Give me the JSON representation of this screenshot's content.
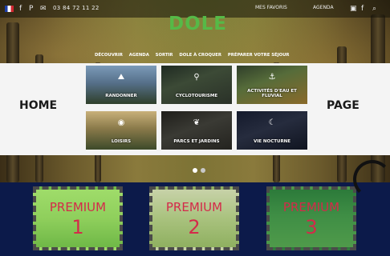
{
  "topbar": {
    "phone": "03 84 72 11 22",
    "left_icons": [
      "flag-icon",
      "facebook-icon",
      "pinterest-icon",
      "mail-icon"
    ],
    "right_link_a": "MES FAVORIS",
    "right_link_b": "AGENDA",
    "right_icons": [
      "bag-icon",
      "facebook-icon",
      "search-icon"
    ]
  },
  "logo": {
    "main": "DOLE",
    "sub": ""
  },
  "nav": [
    "DÉCOUVRIR",
    "AGENDA",
    "SORTIR",
    "DOLE À CROQUER",
    "PRÉPARER VOTRE SÉJOUR"
  ],
  "labels": {
    "home": "HOME",
    "page": "PAGE"
  },
  "tiles": [
    {
      "label": "RANDONNER",
      "icon": "hiker-icon"
    },
    {
      "label": "CYCLOTOURISME",
      "icon": "bike-icon"
    },
    {
      "label": "ACTIVITÉS D'EAU ET FLUVIAL",
      "icon": "boat-icon"
    },
    {
      "label": "LOISIRS",
      "icon": "balloon-icon"
    },
    {
      "label": "PARCS ET JARDINS",
      "icon": "leaf-icon"
    },
    {
      "label": "VIE NOCTURNE",
      "icon": "moon-icon"
    }
  ],
  "premium": [
    {
      "label": "PREMIUM",
      "number": "1"
    },
    {
      "label": "PREMIUM",
      "number": "2"
    },
    {
      "label": "PREMIUM",
      "number": "3"
    }
  ],
  "colors": {
    "brand_green": "#56b947",
    "premium_red": "#d42a4a",
    "bottom_bg": "#0c1a4a"
  }
}
